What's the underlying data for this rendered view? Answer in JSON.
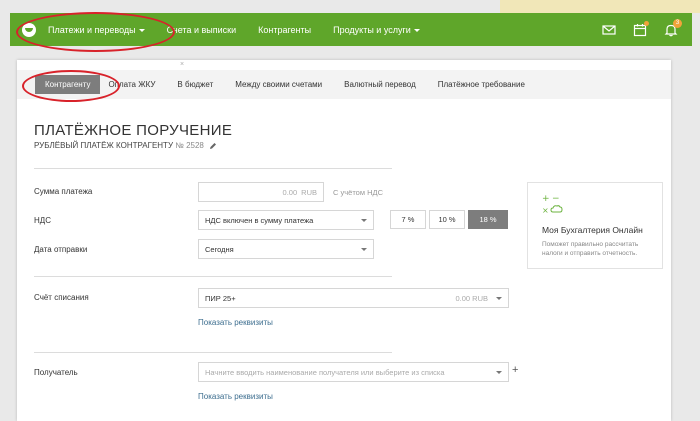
{
  "nav": {
    "items": [
      {
        "label": "Платежи и переводы",
        "dropdown": true
      },
      {
        "label": "Счета и выписки",
        "dropdown": false
      },
      {
        "label": "Контрагенты",
        "dropdown": false
      },
      {
        "label": "Продукты и услуги",
        "dropdown": true
      }
    ],
    "bell_count": "3"
  },
  "tabs": [
    {
      "label": "Контрагенту",
      "active": true
    },
    {
      "label": "Оплата ЖКУ",
      "active": false
    },
    {
      "label": "В бюджет",
      "active": false
    },
    {
      "label": "Между своими счетами",
      "active": false
    },
    {
      "label": "Валютный перевод",
      "active": false
    },
    {
      "label": "Платёжное требование",
      "active": false
    }
  ],
  "form": {
    "title": "ПЛАТЁЖНОЕ ПОРУЧЕНИЕ",
    "subtitle": "РУБЛЁВЫЙ ПЛАТЁЖ КОНТРАГЕНТУ",
    "number": "№ 2528",
    "amount_label": "Сумма платежа",
    "amount_value": "0.00",
    "amount_currency": "RUB",
    "vat_note": "С учётом НДС",
    "vat_label": "НДС",
    "vat_select": "НДС включен в сумму платежа",
    "vat_rates": [
      {
        "label": "7 %",
        "active": false
      },
      {
        "label": "10 %",
        "active": false
      },
      {
        "label": "18 %",
        "active": true
      }
    ],
    "date_label": "Дата отправки",
    "date_value": "Сегодня",
    "account_label": "Счёт списания",
    "account_name": "ПИР 25+",
    "account_balance": "0.00 RUB",
    "show_details_1": "Показать реквизиты",
    "recipient_label": "Получатель",
    "recipient_placeholder": "Начните вводить наименование получателя или выберите из списка",
    "show_details_2": "Показать реквизиты"
  },
  "promo": {
    "title": "Моя Бухгалтерия Онлайн",
    "description": "Поможет правильно рассчитать налоги и отправить отчетность."
  },
  "colors": {
    "nav_green": "#5fa62a",
    "highlight_red": "#d8222a",
    "active_tab_gray": "#7d7d7d",
    "link_blue": "#3d6e8f",
    "badge_orange": "#f2a33a"
  }
}
